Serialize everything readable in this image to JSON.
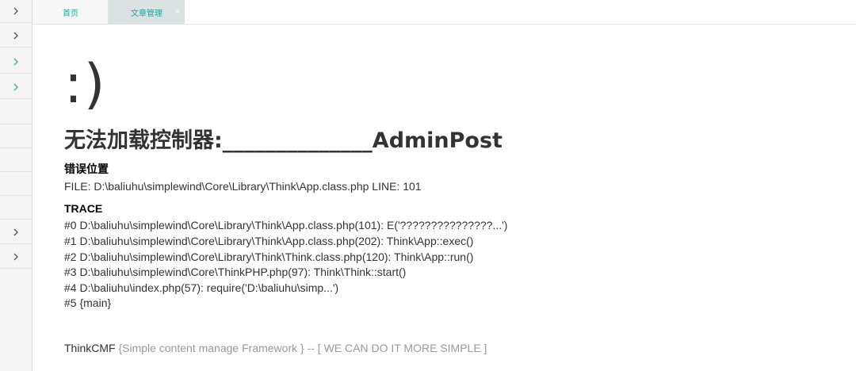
{
  "tabs": {
    "home_label": "首页",
    "article_label": "文章管理",
    "close_glyph": "×"
  },
  "colors": {
    "accent": "#1fa3a3",
    "chevron_active": "#2bb3a3",
    "chevron_default": "#555555"
  },
  "sidebar": {
    "chevron_icon": "chevron-right-icon"
  },
  "error": {
    "face": ":)",
    "headline": "无法加载控制器:______________AdminPost",
    "location_title": "错误位置",
    "file_line": "FILE: D:\\baliuhu\\simplewind\\Core\\Library\\Think\\App.class.php     LINE: 101",
    "trace_title": "TRACE",
    "trace": [
      "#0 D:\\baliuhu\\simplewind\\Core\\Library\\Think\\App.class.php(101): E('???????????????...')",
      "#1 D:\\baliuhu\\simplewind\\Core\\Library\\Think\\App.class.php(202): Think\\App::exec()",
      "#2 D:\\baliuhu\\simplewind\\Core\\Library\\Think\\Think.class.php(120): Think\\App::run()",
      "#3 D:\\baliuhu\\simplewind\\Core\\ThinkPHP.php(97): Think\\Think::start()",
      "#4 D:\\baliuhu\\index.php(57): require('D:\\baliuhu\\simp...')",
      "#5 {main}"
    ]
  },
  "footer": {
    "brand": "ThinkCMF",
    "slogan": "{Simple content manage Framework } -- [ WE CAN DO IT MORE SIMPLE ]"
  }
}
